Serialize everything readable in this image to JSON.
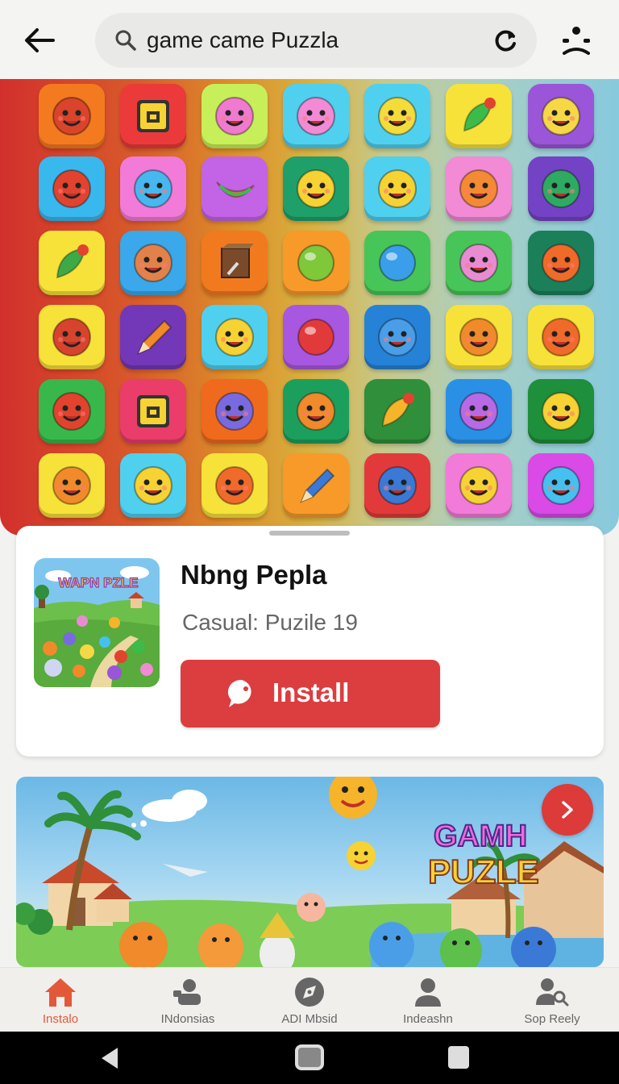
{
  "search": {
    "query": "game came Puzzla"
  },
  "app": {
    "title": "Nbng Pepla",
    "subtitle": "Casual: Puzile 19",
    "install_label": "Install",
    "thumb_logo": "WAPN PZLE"
  },
  "promo": {
    "logo_line1": "GAMH",
    "logo_line2": "PUZLE"
  },
  "nav": [
    {
      "label": "Instalo",
      "icon": "home-icon"
    },
    {
      "label": "INdonsias",
      "icon": "people-icon"
    },
    {
      "label": "ADI Mbsid",
      "icon": "compass-icon"
    },
    {
      "label": "Indeashn",
      "icon": "person-icon"
    },
    {
      "label": "Sop Reely",
      "icon": "account-search-icon"
    }
  ],
  "colors": {
    "accent": "#dc3d3f",
    "active_nav": "#e4583a"
  },
  "grid_tiles": [
    {
      "bg": "#f47a20",
      "fg": "#d9442a",
      "icon": "face"
    },
    {
      "bg": "#ec3a3a",
      "fg": "#f6d233",
      "icon": "disk"
    },
    {
      "bg": "#c7ef59",
      "fg": "#f07ad0",
      "icon": "face"
    },
    {
      "bg": "#4fd0ef",
      "fg": "#f28ad6",
      "icon": "face"
    },
    {
      "bg": "#4fd0ef",
      "fg": "#f4dc3a",
      "icon": "face"
    },
    {
      "bg": "#f7e23a",
      "fg": "#3dbb4a",
      "icon": "leaf"
    },
    {
      "bg": "#9a55d8",
      "fg": "#f6d846",
      "icon": "face"
    },
    {
      "bg": "#39b8ee",
      "fg": "#e2432e",
      "icon": "face"
    },
    {
      "bg": "#f27ad8",
      "fg": "#46b8ef",
      "icon": "face"
    },
    {
      "bg": "#c363e6",
      "fg": "#e86a2a",
      "icon": "banana"
    },
    {
      "bg": "#1f9f6a",
      "fg": "#f6d233",
      "icon": "face"
    },
    {
      "bg": "#4fd0ef",
      "fg": "#f6d233",
      "icon": "face"
    },
    {
      "bg": "#f28ad6",
      "fg": "#f58a34",
      "icon": "face"
    },
    {
      "bg": "#7442c4",
      "fg": "#2faa62",
      "icon": "face"
    },
    {
      "bg": "#f7e23a",
      "fg": "#3da947",
      "icon": "leaf"
    },
    {
      "bg": "#3aa8ea",
      "fg": "#e2824a",
      "icon": "face"
    },
    {
      "bg": "#f27a1e",
      "fg": "#7a4a2a",
      "icon": "box"
    },
    {
      "bg": "#f79a2a",
      "fg": "#7ec83a",
      "icon": "ball"
    },
    {
      "bg": "#47c558",
      "fg": "#3a9eea",
      "icon": "ball"
    },
    {
      "bg": "#47c558",
      "fg": "#e98bd2",
      "icon": "face"
    },
    {
      "bg": "#1b7f5a",
      "fg": "#f06a2a",
      "icon": "face"
    },
    {
      "bg": "#f7e23a",
      "fg": "#d8432e",
      "icon": "face"
    },
    {
      "bg": "#7338b8",
      "fg": "#f08a2a",
      "icon": "pencil"
    },
    {
      "bg": "#4fd0ef",
      "fg": "#f6d233",
      "icon": "face"
    },
    {
      "bg": "#a857e0",
      "fg": "#e23a3a",
      "icon": "ball"
    },
    {
      "bg": "#2582d6",
      "fg": "#4a9ee8",
      "icon": "face"
    },
    {
      "bg": "#f7e23a",
      "fg": "#f08a2a",
      "icon": "face"
    },
    {
      "bg": "#f7e23a",
      "fg": "#f06a2a",
      "icon": "face"
    },
    {
      "bg": "#38b84a",
      "fg": "#e2432e",
      "icon": "face"
    },
    {
      "bg": "#ea3d6a",
      "fg": "#f6d233",
      "icon": "disk"
    },
    {
      "bg": "#f06a1e",
      "fg": "#7a6ae0",
      "icon": "face"
    },
    {
      "bg": "#1c9f5c",
      "fg": "#f08a2a",
      "icon": "face"
    },
    {
      "bg": "#2f8f3a",
      "fg": "#f6b42a",
      "icon": "leaf"
    },
    {
      "bg": "#2a90e6",
      "fg": "#b86ae6",
      "icon": "face"
    },
    {
      "bg": "#1e8f3a",
      "fg": "#f6d233",
      "icon": "face"
    },
    {
      "bg": "#f7e23a",
      "fg": "#f08a2a",
      "icon": "face"
    },
    {
      "bg": "#4fd0ef",
      "fg": "#f6d233",
      "icon": "face"
    },
    {
      "bg": "#f7e23a",
      "fg": "#f06a2a",
      "icon": "face"
    },
    {
      "bg": "#f79a2a",
      "fg": "#3a7ad6",
      "icon": "pencil"
    },
    {
      "bg": "#e23a3a",
      "fg": "#3a7ad6",
      "icon": "face"
    },
    {
      "bg": "#f27ad8",
      "fg": "#f6d233",
      "icon": "face"
    },
    {
      "bg": "#d94ae6",
      "fg": "#46c0ef",
      "icon": "face"
    }
  ]
}
